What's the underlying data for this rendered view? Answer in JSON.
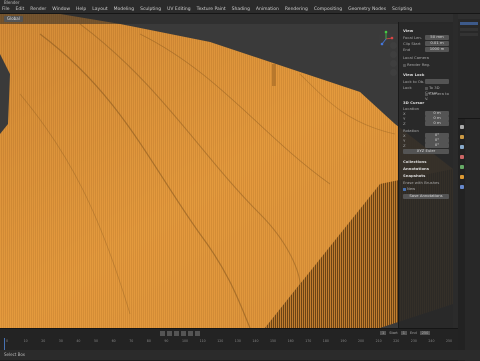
{
  "window": {
    "title": "Blender"
  },
  "menu": [
    "File",
    "Edit",
    "Render",
    "Window",
    "Help",
    "Layout",
    "Modeling",
    "Sculpting",
    "UV Editing",
    "Texture Paint",
    "Shading",
    "Animation",
    "Rendering",
    "Compositing",
    "Geometry Nodes",
    "Scripting"
  ],
  "viewport_header": {
    "mode_button": "Global"
  },
  "n_panel": {
    "view_title": "View",
    "focal_label": "Focal Len.",
    "focal_value": "50 mm",
    "clip_start_label": "Clip Start",
    "clip_start_value": "0.01 m",
    "end_label": "End",
    "end_value": "1000 m",
    "local_camera_label": "Local Camera",
    "render_region_label": "Render Reg.",
    "view_lock_title": "View Lock",
    "lock_object_label": "Lock to Ob.",
    "lock_label": "Lock",
    "lock_3d_cursor": "To 3D Cursor",
    "lock_camera": "Camera to V.",
    "cursor_title": "3D Cursor",
    "location_label": "Location",
    "cursor_x_label": "X",
    "cursor_x": "0 m",
    "cursor_y_label": "Y",
    "cursor_y": "0 m",
    "cursor_z_label": "Z",
    "cursor_z": "0 m",
    "rotation_label": "Rotation",
    "rot_x_label": "X",
    "rot_x": "0°",
    "rot_y_label": "Y",
    "rot_y": "0°",
    "rot_z_label": "Z",
    "rot_z": "0°",
    "mode_value": "XYZ Euler",
    "collections_title": "Collections",
    "annotations_title": "Annotations",
    "snapshots_title": "Snapshots",
    "note_label": "Erase with Brushes",
    "new_label": "New",
    "nav_label": "Save Annotations"
  },
  "timeline": {
    "frame_ticks": [
      "0",
      "10",
      "20",
      "30",
      "40",
      "50",
      "60",
      "70",
      "80",
      "90",
      "100",
      "110",
      "120",
      "130",
      "140",
      "150",
      "160",
      "170",
      "180",
      "190",
      "200",
      "210",
      "220",
      "230",
      "240",
      "250"
    ],
    "start_label": "Start",
    "start_value": "1",
    "end_label": "End",
    "end_value": "250",
    "current_frame": "1"
  },
  "status_bar": {
    "left_text": "Select Box",
    "right_text": ""
  },
  "colors": {
    "terrain": "#e89a3a",
    "accent": "#4772b3",
    "bg": "#1d1d1d"
  }
}
